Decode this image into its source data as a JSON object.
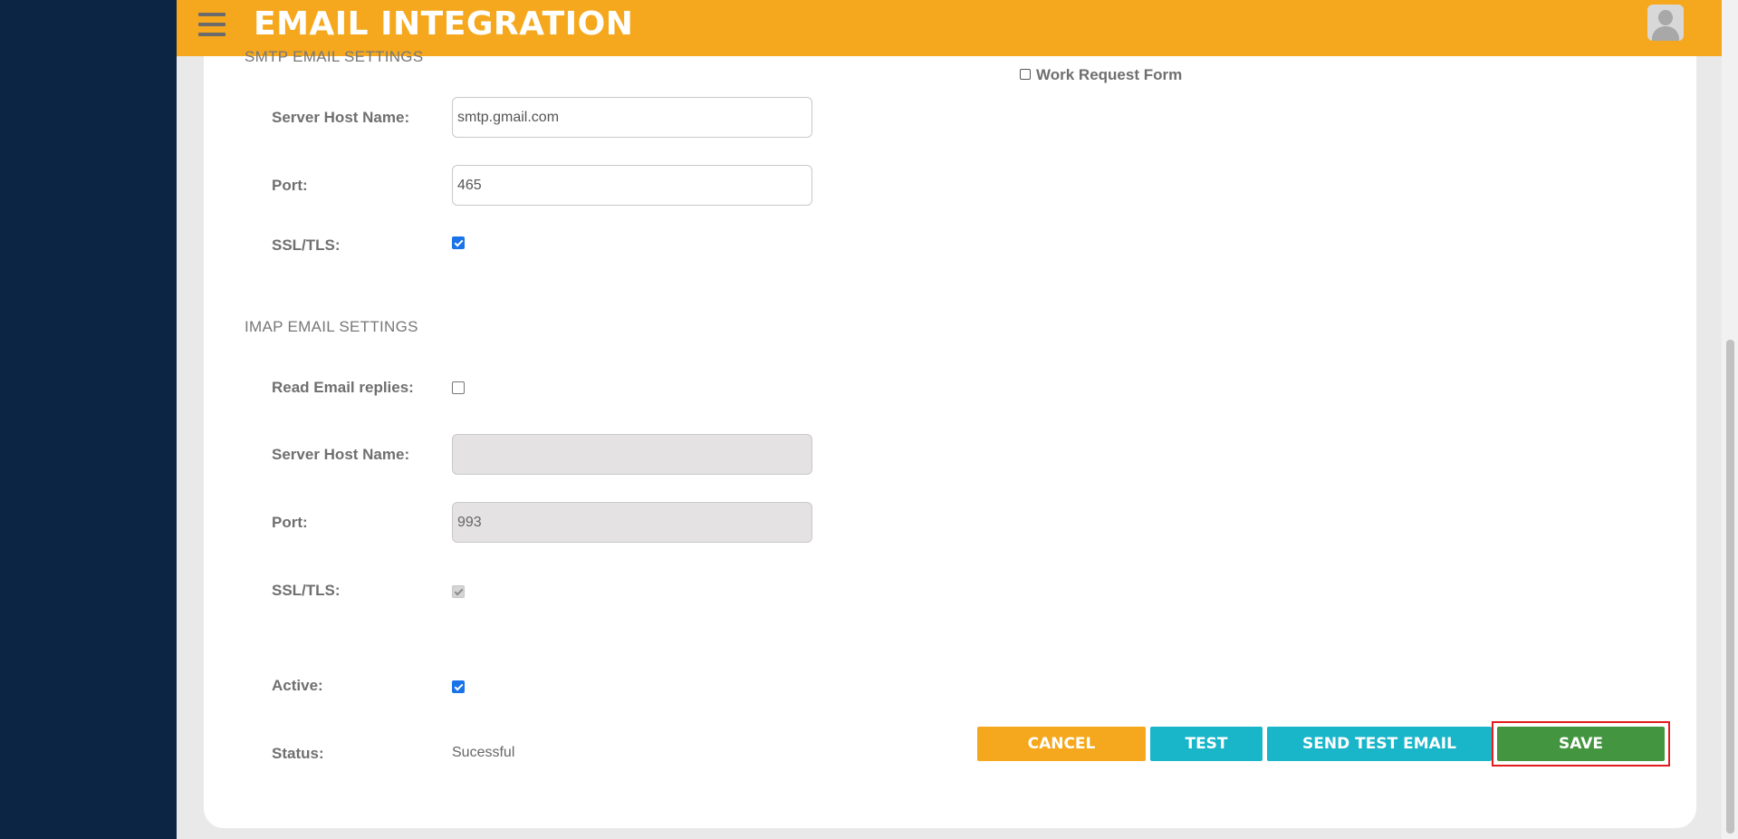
{
  "header": {
    "title": "EMAIL INTEGRATION"
  },
  "smtp": {
    "section_title": "SMTP EMAIL SETTINGS",
    "host_label": "Server Host Name:",
    "host_value": "smtp.gmail.com",
    "port_label": "Port:",
    "port_value": "465",
    "ssl_label": "SSL/TLS:",
    "ssl_checked": true
  },
  "imap": {
    "section_title": "IMAP EMAIL SETTINGS",
    "read_replies_label": "Read Email replies:",
    "read_replies_checked": false,
    "host_label": "Server Host Name:",
    "host_value": "",
    "port_label": "Port:",
    "port_value": "993",
    "ssl_label": "SSL/TLS:",
    "ssl_checked": true
  },
  "work_request": {
    "label": "Work Request Form",
    "checked": false
  },
  "active": {
    "label": "Active:",
    "checked": true
  },
  "status": {
    "label": "Status:",
    "value": "Sucessful"
  },
  "actions": {
    "cancel_label": "CANCEL",
    "test_label": "TEST",
    "send_test_label": "SEND TEST EMAIL",
    "save_label": "SAVE"
  },
  "colors": {
    "header": "#f5a81d",
    "sidebar": "#0c2544",
    "cancel": "#f5a81d",
    "test": "#19b5c9",
    "save": "#43963f",
    "highlight": "#e31b1b"
  },
  "icons": {
    "menu": "hamburger-menu-icon",
    "user": "user-avatar-icon"
  }
}
